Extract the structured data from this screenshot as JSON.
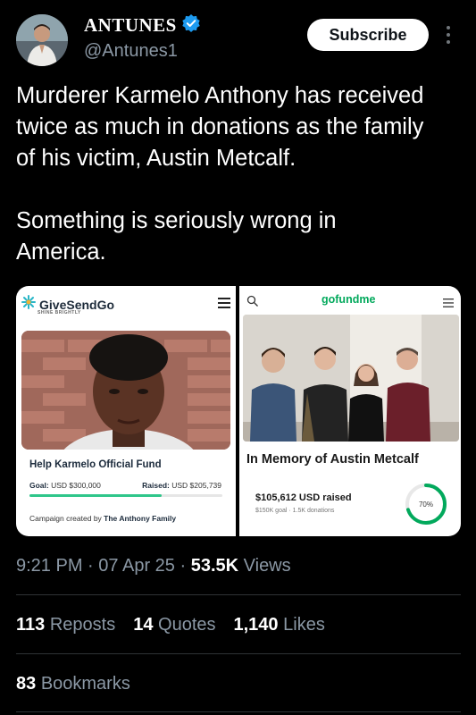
{
  "author": {
    "name": "ANTUNES",
    "handle": "@Antunes1",
    "verified_color": "#1d9bf0"
  },
  "subscribe_label": "Subscribe",
  "tweet": {
    "text": "Murderer Karmelo Anthony has received\ntwice as much in donations as the family\nof his victim, Austin Metcalf.\n\nSomething is seriously wrong in\nAmerica."
  },
  "media": {
    "left": {
      "brand": "GiveSendGo",
      "tagline": "SHINE BRIGHTLY",
      "fund_title": "Help Karmelo Official Fund",
      "goal_label": "Goal:",
      "goal_value": "USD $300,000",
      "raised_label": "Raised:",
      "raised_value": "USD $205,739",
      "progress_fraction": 0.686,
      "created_prefix": "Campaign created by ",
      "created_by": "The Anthony Family",
      "accent": "#2fc68a"
    },
    "right": {
      "brand": "gofundme",
      "title": "In Memory of Austin Metcalf",
      "raised": "$105,612 USD raised",
      "goal": "$150K goal",
      "donations": "1.5K donations",
      "dot": "·",
      "percent": "70%",
      "progress_fraction": 0.7,
      "accent": "#02a95c"
    }
  },
  "meta": {
    "time": "9:21 PM",
    "dot": "·",
    "date": "07 Apr 25",
    "views_count": "53.5K",
    "views_label": "Views"
  },
  "stats": {
    "reposts_count": "113",
    "reposts_label": "Reposts",
    "quotes_count": "14",
    "quotes_label": "Quotes",
    "likes_count": "1,140",
    "likes_label": "Likes",
    "bookmarks_count": "83",
    "bookmarks_label": "Bookmarks"
  }
}
